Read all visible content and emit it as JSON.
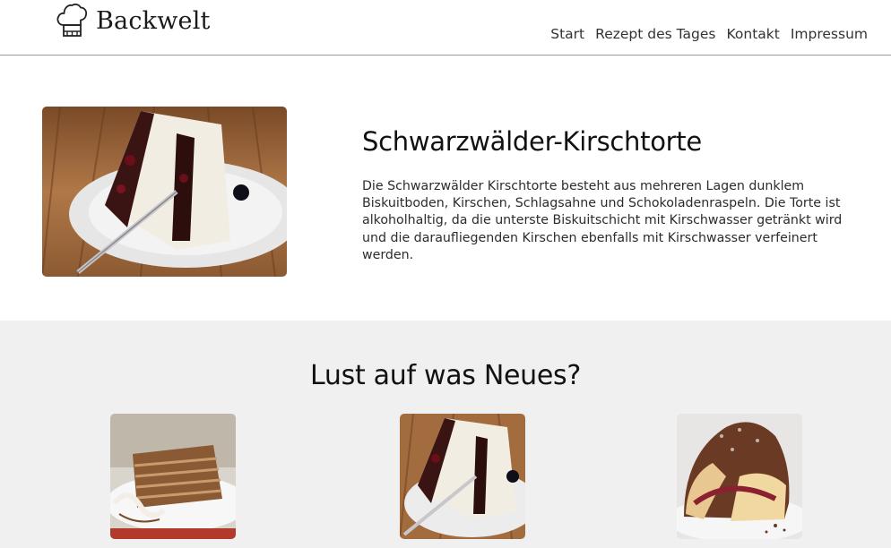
{
  "brand": {
    "name": "Backwelt",
    "icon": "chef-hat-icon"
  },
  "nav": [
    {
      "label": "Start"
    },
    {
      "label": "Rezept des Tages"
    },
    {
      "label": "Kontakt"
    },
    {
      "label": "Impressum"
    }
  ],
  "hero": {
    "title": "Schwarzwälder-Kirschtorte",
    "text": "Die Schwarzwälder Kirschtorte besteht aus mehreren Lagen dunklem Biskuitboden, Kirschen, Schlagsahne und Schokoladenraspeln. Die Torte ist alkoholhaltig, da die unterste Biskuitschicht mit Kirschwasser getränkt wird und die daraufliegenden Kirschen ebenfalls mit Kirschwasser verfeinert werden."
  },
  "suggestions": {
    "title": "Lust auf was Neues?"
  },
  "colors": {
    "section_bg": "#f0f0f0",
    "divider": "#9a9a9a",
    "text": "#1e1e1e"
  }
}
